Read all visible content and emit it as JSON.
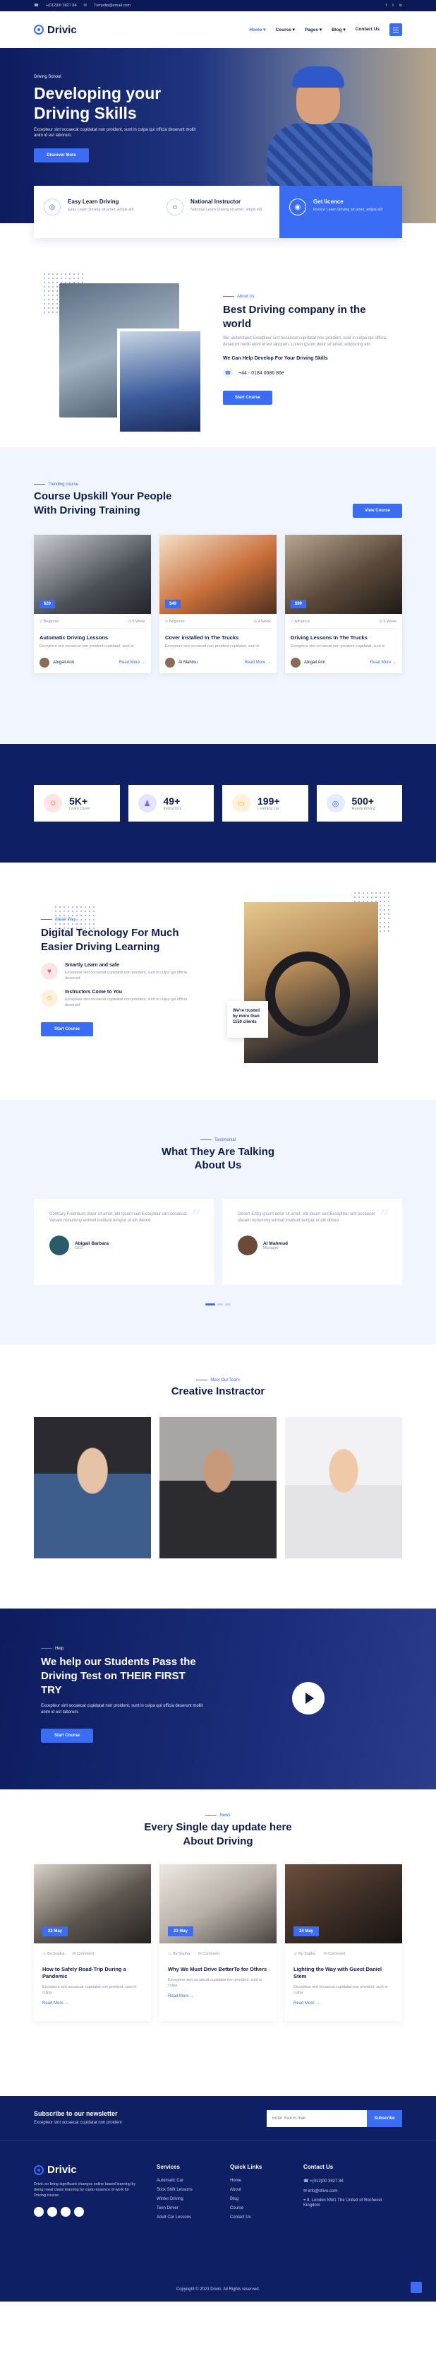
{
  "topbar": {
    "phone": "+(012)00 3827 84",
    "email": "Tumpdip@email.com"
  },
  "nav": {
    "logo": "Drivic",
    "menu": [
      "Home ▾",
      "Course ▾",
      "Pages ▾",
      "Blog ▾",
      "Contact Us"
    ]
  },
  "hero": {
    "kicker": "Driving School",
    "title": "Developing your Driving Skills",
    "desc": "Excepteur sint occaecat cupidatat non proident, sunt in culpa qui officia deserunt mollit anim id est laborum.",
    "button": "Discover More"
  },
  "features": [
    {
      "title": "Easy Learn Driving",
      "desc": "Easy Learn Driving sit amet, adipis elit"
    },
    {
      "title": "National Instructor",
      "desc": "National Learn Driving sit amet, adipis elit"
    },
    {
      "title": "Get licence",
      "desc": "licence Learn Driving sit amet, adipis elit"
    }
  ],
  "about": {
    "tag": "About Us",
    "title": "Best Driving company in the world",
    "desc": "We understand Excepteur sint occaecat cupidatat non proident, sunt in culpa qui officia deserunt mollit anim id est laborum. Lorem ipsum dolor sit amet, adipiscing elit.",
    "subtitle": "We Can Help Develop For Your Driving Skills",
    "phone": "+44 - 0184 0686 86e",
    "button": "Start Course"
  },
  "courses": {
    "tag": "Trending course",
    "title": "Course Upskill Your People With Driving Training",
    "button": "View Course",
    "items": [
      {
        "price": "$29",
        "level": "Beginner",
        "duration": "5 Week",
        "title": "Automatic Driving Lessons",
        "desc": "Excepteur sint occaecat non proident cupidatat, sunt in",
        "author": "Abigail Ann",
        "more": "Read More →"
      },
      {
        "price": "$49",
        "level": "Beginner",
        "duration": "4 Week",
        "title": "Cover installed In The Trucks",
        "desc": "Excepteur sint occaecat non proident cupidatat, sunt in",
        "author": "Al Mahmu",
        "more": "Read More →"
      },
      {
        "price": "$99",
        "level": "Advance",
        "duration": "6 Week",
        "title": "Driving Lessons In The Trucks",
        "desc": "Excepteur sint occaecat non proident cupidatat, sunt in",
        "author": "Abigail Ann",
        "more": "Read More →"
      }
    ]
  },
  "stats": [
    {
      "value": "5K+",
      "label": "Learn Driver",
      "color": "#ffe3e5",
      "icon_color": "#f05a6a"
    },
    {
      "value": "49+",
      "label": "Instructors",
      "color": "#e4e4ff",
      "icon_color": "#6c63ff"
    },
    {
      "value": "199+",
      "label": "Learning car",
      "color": "#fff1d9",
      "icon_color": "#f2a541"
    },
    {
      "value": "500+",
      "label": "Ready driving",
      "color": "#e4ecff",
      "icon_color": "#3b6cf4"
    }
  ],
  "smart": {
    "tag": "Smart Way",
    "title": "Digital Tecnology For Much Easier Driving Learning",
    "items": [
      {
        "title": "Smartly Learn and safe",
        "desc": "Excepteur sint occaecat cupidatat non proident, sunt in culpa qui officia deserunt",
        "color": "#ffe3e5"
      },
      {
        "title": "Instructors Come to You",
        "desc": "Excepteur sint occaecat cupidatat non proident, sunt in culpa qui officia deserunt",
        "color": "#fff1d9"
      }
    ],
    "button": "Start Course",
    "badge": "We're trusted by more than 1150 clients"
  },
  "testimonials": {
    "tag": "Testimonial",
    "title": "What They Are Talking About Us",
    "items": [
      {
        "text": "Contrary Freemium dolor sit amet, elit ipsum sed Excepteur sint occaecat Vasam nonummy eirmod invidunt tempor ut elit dolore",
        "name": "Abigail Barbara",
        "role": "CEO"
      },
      {
        "text": "Desert Entry ipsum dolor sit amet, elit ipsum sed Excepteur sint occaecat Vasam nonummy eirmod invidunt tempor ut elit dolore",
        "name": "Al Mahmud",
        "role": "Manager"
      }
    ]
  },
  "team": {
    "tag": "Meet Our Team",
    "title": "Creative Instractor"
  },
  "cta": {
    "kicker": "Help",
    "title": "We help our Students Pass the Driving Test on THEIR FIRST TRY",
    "desc": "Excepteur sint occaecat cupidatat non proident, sunt in culpa qui officia deserunt mollit anim id est laborum.",
    "button": "Start Course"
  },
  "news": {
    "tag": "News",
    "title": "Every Single day update here About Driving",
    "items": [
      {
        "date": "22 May",
        "author": "By Sopha",
        "comments": "Comment",
        "title": "How to Safely Road-Trip During a Pandemic",
        "desc": "Excepteur sint occaecat cupidatat non proident, sunt in culpa",
        "more": "Read More →"
      },
      {
        "date": "23 May",
        "author": "By Sopha",
        "comments": "Comment",
        "title": "Why We Must Drive BetterTo for Others",
        "desc": "Excepteur sint occaecat cupidatat non proident, sunt in culpa",
        "more": "Read More →"
      },
      {
        "date": "24 May",
        "author": "By Sopha",
        "comments": "Comment",
        "title": "Lighting the Way with Guest Daniel Stem",
        "desc": "Excepteur sint occaecat cupidatat non proident, sunt in culpa",
        "more": "Read More →"
      }
    ]
  },
  "footer": {
    "newsletter_title": "Subscribe to our newsletter",
    "newsletter_desc": "Excepteur sint occaecat cupidatat non proident",
    "email_placeholder": "Enter Your E-mail",
    "subscribe": "Subscribe",
    "logo": "Drivic",
    "about": "Drivic so bring significant changes online based learning by doing reeal classi learning by cupto essence of work for Driving course",
    "services_title": "Services",
    "services": [
      "Automatic Car",
      "Stick Shift Lessons",
      "Winter Driving",
      "Teen Driver",
      "Adult Car Lessons"
    ],
    "links_title": "Quick Links",
    "links": [
      "Home",
      "About",
      "Blog",
      "Course",
      "Contact Us"
    ],
    "contact_title": "Contact Us",
    "phone": "+(012)00 3827 84",
    "email": "info@drive.com",
    "address": "8, London NW1 The United of Rochecet Kingdom",
    "copyright": "Copyright © 2023 Drivic. All Rights reserved."
  }
}
